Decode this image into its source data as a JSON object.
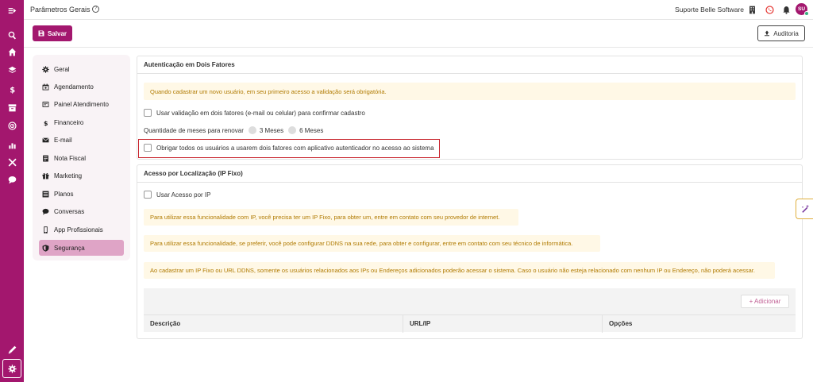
{
  "header": {
    "title": "Parâmetros Gerais",
    "company": "Suporte Belle Software",
    "avatar_initials": "SU",
    "brand_color": "#a3176e"
  },
  "actions": {
    "save_label": "Salvar",
    "audit_label": "Auditoria"
  },
  "sidebar": {
    "icons": [
      "menu-collapse-icon",
      "search-icon",
      "home-icon",
      "layers-icon",
      "dollar-icon",
      "box-icon",
      "target-icon",
      "chart-icon",
      "tools-icon",
      "chat-icon",
      "pencil-icon",
      "gear-icon"
    ]
  },
  "menu": {
    "items": [
      {
        "label": "Geral",
        "icon": "gear-icon"
      },
      {
        "label": "Agendamento",
        "icon": "calendar-icon"
      },
      {
        "label": "Painel Atendimento",
        "icon": "panel-icon"
      },
      {
        "label": "Financeiro",
        "icon": "dollar-icon"
      },
      {
        "label": "E-mail",
        "icon": "envelope-icon"
      },
      {
        "label": "Nota Fiscal",
        "icon": "receipt-icon"
      },
      {
        "label": "Marketing",
        "icon": "gift-icon"
      },
      {
        "label": "Planos",
        "icon": "list-icon"
      },
      {
        "label": "Conversas",
        "icon": "chat-icon"
      },
      {
        "label": "App Profissionais",
        "icon": "phone-icon"
      },
      {
        "label": "Segurança",
        "icon": "shield-icon"
      }
    ],
    "active": "Segurança"
  },
  "two_factor": {
    "title": "Autenticação em Dois Fatores",
    "notice": "Quando cadastrar um novo usuário, em seu primeiro acesso a validação será obrigatória.",
    "use_validation_label": "Usar validação em dois fatores (e-mail ou celular) para confirmar cadastro",
    "renew_label": "Quantidade de meses para renovar",
    "option_3": "3 Meses",
    "option_6": "6 Meses",
    "force_app_label": "Obrigar todos os usuários a usarem dois fatores com aplicativo autenticador no acesso ao sistema"
  },
  "location": {
    "title": "Acesso por Localização (IP Fixo)",
    "use_ip_label": "Usar Acesso por IP",
    "notice_1": "Para utilizar essa funcionalidade com IP, você precisa ter um IP Fixo, para obter um, entre em contato com seu provedor de internet.",
    "notice_2": "Para utilizar essa funcionalidade, se preferir, você pode configurar DDNS na sua rede, para obter e configurar, entre em contato com seu técnico de informática.",
    "notice_3": "Ao cadastrar um IP Fixo ou URL DDNS, somente os usuários relacionados aos IPs ou Endereços adicionados poderão acessar o sistema. Caso o usuário não esteja relacionado com nenhum IP ou Endereço, não poderá acessar.",
    "add_label": "+ Adicionar",
    "columns": [
      "Descrição",
      "URL/IP",
      "Opções"
    ]
  }
}
